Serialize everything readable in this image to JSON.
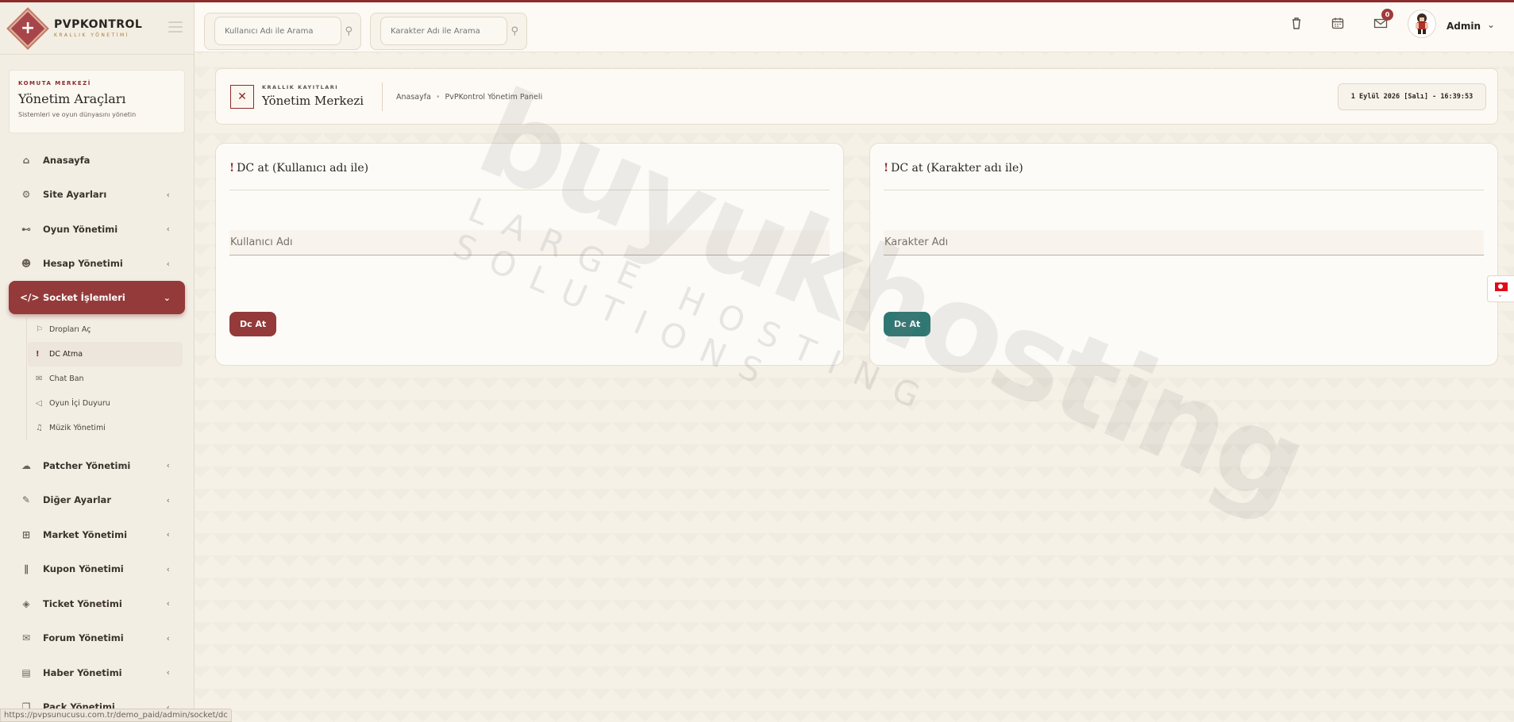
{
  "brand": {
    "name": "PVPKONTROL",
    "subtitle": "KRALLIK YÖNETİMİ"
  },
  "tools_card": {
    "kicker": "KOMUTA MERKEZİ",
    "title": "Yönetim Araçları",
    "description": "Sistemleri ve oyun dünyasını yönetin"
  },
  "menu": [
    {
      "label": "Anasayfa",
      "icon": "home-icon",
      "glyph": "⌂",
      "has_children": false
    },
    {
      "label": "Site Ayarları",
      "icon": "gear-icon",
      "glyph": "⚙",
      "has_children": true
    },
    {
      "label": "Oyun Yönetimi",
      "icon": "gamepad-icon",
      "glyph": "⊷",
      "has_children": true
    },
    {
      "label": "Hesap Yönetimi",
      "icon": "users-icon",
      "glyph": "☻",
      "has_children": true
    },
    {
      "label": "Socket İşlemleri",
      "icon": "code-icon",
      "glyph": "</>",
      "has_children": true,
      "active": true
    },
    {
      "label": "Patcher Yönetimi",
      "icon": "cloud-upload-icon",
      "glyph": "☁",
      "has_children": true
    },
    {
      "label": "Diğer Ayarlar",
      "icon": "wrench-icon",
      "glyph": "✎",
      "has_children": true
    },
    {
      "label": "Market Yönetimi",
      "icon": "cart-icon",
      "glyph": "⊞",
      "has_children": true
    },
    {
      "label": "Kupon Yönetimi",
      "icon": "barcode-icon",
      "glyph": "∥",
      "has_children": true
    },
    {
      "label": "Ticket Yönetimi",
      "icon": "ticket-icon",
      "glyph": "◈",
      "has_children": true
    },
    {
      "label": "Forum Yönetimi",
      "icon": "comments-icon",
      "glyph": "✉",
      "has_children": true
    },
    {
      "label": "Haber Yönetimi",
      "icon": "newspaper-icon",
      "glyph": "▤",
      "has_children": true
    },
    {
      "label": "Pack Yönetimi",
      "icon": "clone-icon",
      "glyph": "❐",
      "has_children": true
    }
  ],
  "submenu": [
    {
      "label": "Dropları Aç",
      "icon": "gift-icon",
      "glyph": "⚐"
    },
    {
      "label": "DC Atma",
      "icon": "exclamation-icon",
      "glyph": "!",
      "current": true
    },
    {
      "label": "Chat Ban",
      "icon": "chat-icon",
      "glyph": "✉"
    },
    {
      "label": "Oyun İçi Duyuru",
      "icon": "megaphone-icon",
      "glyph": "📢"
    },
    {
      "label": "Müzik Yönetimi",
      "icon": "music-icon",
      "glyph": "♫"
    }
  ],
  "header": {
    "search_user_placeholder": "Kullanıcı Adı ile Arama",
    "search_char_placeholder": "Karakter Adı ile Arama",
    "notification_count": "0",
    "user_name": "Admin"
  },
  "breadcrumb": {
    "kicker": "KRALLIK KAYITLARI",
    "title": "Yönetim Merkezi",
    "path": [
      "Anasayfa",
      "PvPKontrol Yönetim Paneli"
    ],
    "datetime": "1 Eylül 2026 [Salı] - 16:39:53"
  },
  "forms": [
    {
      "title": "DC at (Kullanıcı adı ile)",
      "placeholder": "Kullanıcı Adı",
      "button": "Dc At",
      "button_color": "#943a3a"
    },
    {
      "title": "DC at (Karakter adı ile)",
      "placeholder": "Karakter Adı",
      "button": "Dc At",
      "button_color": "#2f7773"
    }
  ],
  "watermark": {
    "main": "buyukhosting",
    "sub": "LARGE HOSTING SOLUTIONS"
  },
  "status_url": "https://pvpsunucusu.com.tr/demo_paid/admin/socket/dc",
  "colors": {
    "accent": "#943a3a",
    "teal": "#2f7773",
    "background": "#f6f1e7"
  }
}
